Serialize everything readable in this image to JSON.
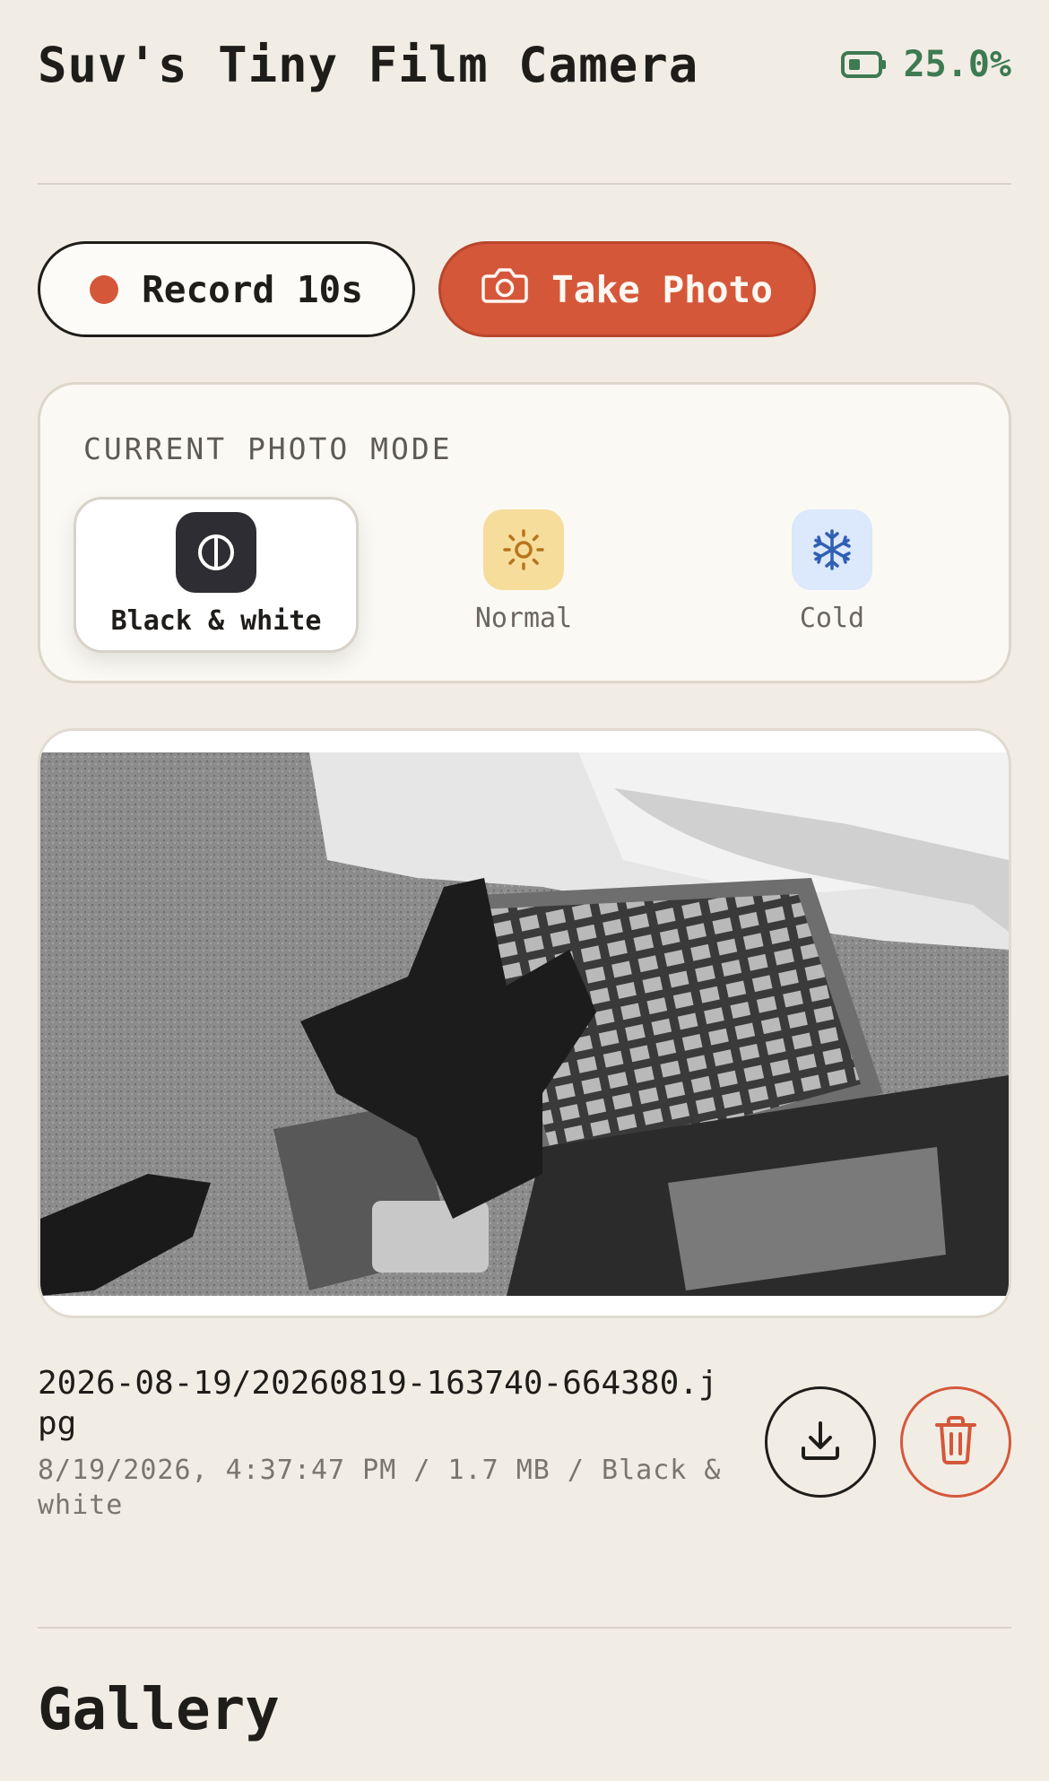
{
  "header": {
    "title": "Suv's Tiny Film Camera",
    "battery_icon": "battery-icon",
    "battery_level": "25.0%",
    "battery_color": "#3e7a52"
  },
  "actions": {
    "record_label": "Record 10s",
    "record_icon": "record-dot-icon",
    "photo_label": "Take Photo",
    "photo_icon": "camera-icon",
    "accent_color": "#d5573a"
  },
  "mode": {
    "heading": "CURRENT PHOTO MODE",
    "options": [
      {
        "label": "Black & white",
        "icon": "contrast-icon",
        "selected": true
      },
      {
        "label": "Normal",
        "icon": "sun-icon",
        "selected": false
      },
      {
        "label": "Cold",
        "icon": "snowflake-icon",
        "selected": false
      }
    ]
  },
  "latest_photo": {
    "filename": "2026-08-19/20260819-163740-664380.jpg",
    "meta": "8/19/2026, 4:37:47 PM / 1.7 MB / Black & white",
    "download_icon": "download-icon",
    "delete_icon": "trash-icon"
  },
  "gallery": {
    "title": "Gallery"
  }
}
